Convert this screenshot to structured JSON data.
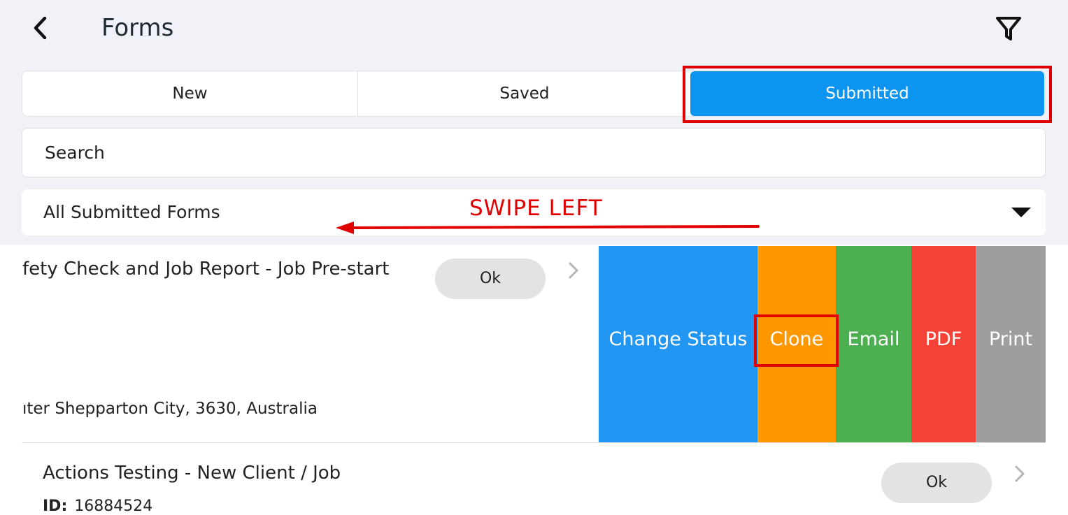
{
  "header": {
    "title": "Forms",
    "back_icon": "chevron-left-icon",
    "filter_icon": "filter-icon"
  },
  "tabs": [
    {
      "label": "New"
    },
    {
      "label": "Saved"
    },
    {
      "label": "Submitted",
      "selected": true
    }
  ],
  "search": {
    "placeholder": "Search"
  },
  "filter_dropdown": {
    "selected": "All Submitted Forms"
  },
  "annotation": {
    "text": "SWIPE LEFT",
    "color": "#e00000"
  },
  "rows": [
    {
      "title": "fety Check and Job Report - Job Pre-start",
      "status": "Ok",
      "address": "ıter Shepparton City, 3630, Australia"
    },
    {
      "title": "Actions Testing - New Client / Job",
      "status": "Ok",
      "id_label": "ID:",
      "id_value": "16884524"
    }
  ],
  "swipe_actions": [
    {
      "label": "Change Status",
      "color": "#2196f3"
    },
    {
      "label": "Clone",
      "color": "#ff9800"
    },
    {
      "label": "Email",
      "color": "#4caf50"
    },
    {
      "label": "PDF",
      "color": "#f44336"
    },
    {
      "label": "Print",
      "color": "#9e9e9e"
    }
  ],
  "colors": {
    "accent": "#0d93f0",
    "highlight": "#e00000"
  }
}
